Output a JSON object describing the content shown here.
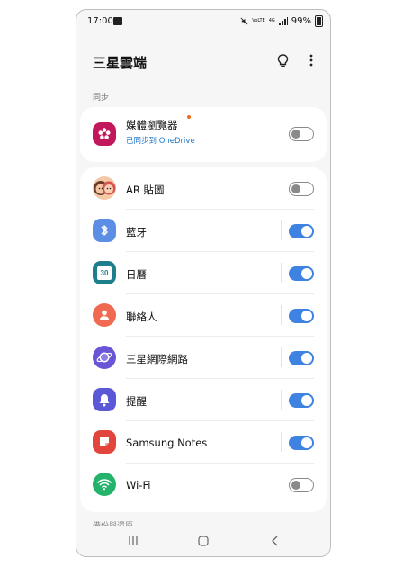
{
  "status": {
    "time": "17:00",
    "battery": "99%",
    "vowifi": "VoLTE",
    "network": "4G"
  },
  "header": {
    "title": "三星雲端"
  },
  "sync": {
    "section_label": "同步",
    "gallery": {
      "label": "媒體瀏覽器",
      "sub": "已同步到 OneDrive",
      "on": false
    }
  },
  "apps": [
    {
      "label": "AR 貼圖",
      "on": false,
      "icon": "ar-emoji-icon"
    },
    {
      "label": "藍牙",
      "on": true,
      "icon": "bluetooth-icon"
    },
    {
      "label": "日曆",
      "on": true,
      "icon": "calendar-icon",
      "badge": "30"
    },
    {
      "label": "聯絡人",
      "on": true,
      "icon": "contacts-icon"
    },
    {
      "label": "三星網際網路",
      "on": true,
      "icon": "internet-icon"
    },
    {
      "label": "提醒",
      "on": true,
      "icon": "reminder-icon"
    },
    {
      "label": "Samsung Notes",
      "on": true,
      "icon": "notes-icon"
    },
    {
      "label": "Wi-Fi",
      "on": false,
      "icon": "wifi-icon"
    }
  ],
  "footer": {
    "cut_label": "備份與還原"
  },
  "colors": {
    "accent": "#3e83e2",
    "gallery": "#c2185b",
    "bluetooth": "#5c8ee6",
    "calendar": "#1d7f8c",
    "contacts": "#f06a52",
    "internet": "#6a55d6",
    "reminder": "#5a58d6",
    "notes": "#e2453c",
    "wifi": "#23b36b"
  }
}
